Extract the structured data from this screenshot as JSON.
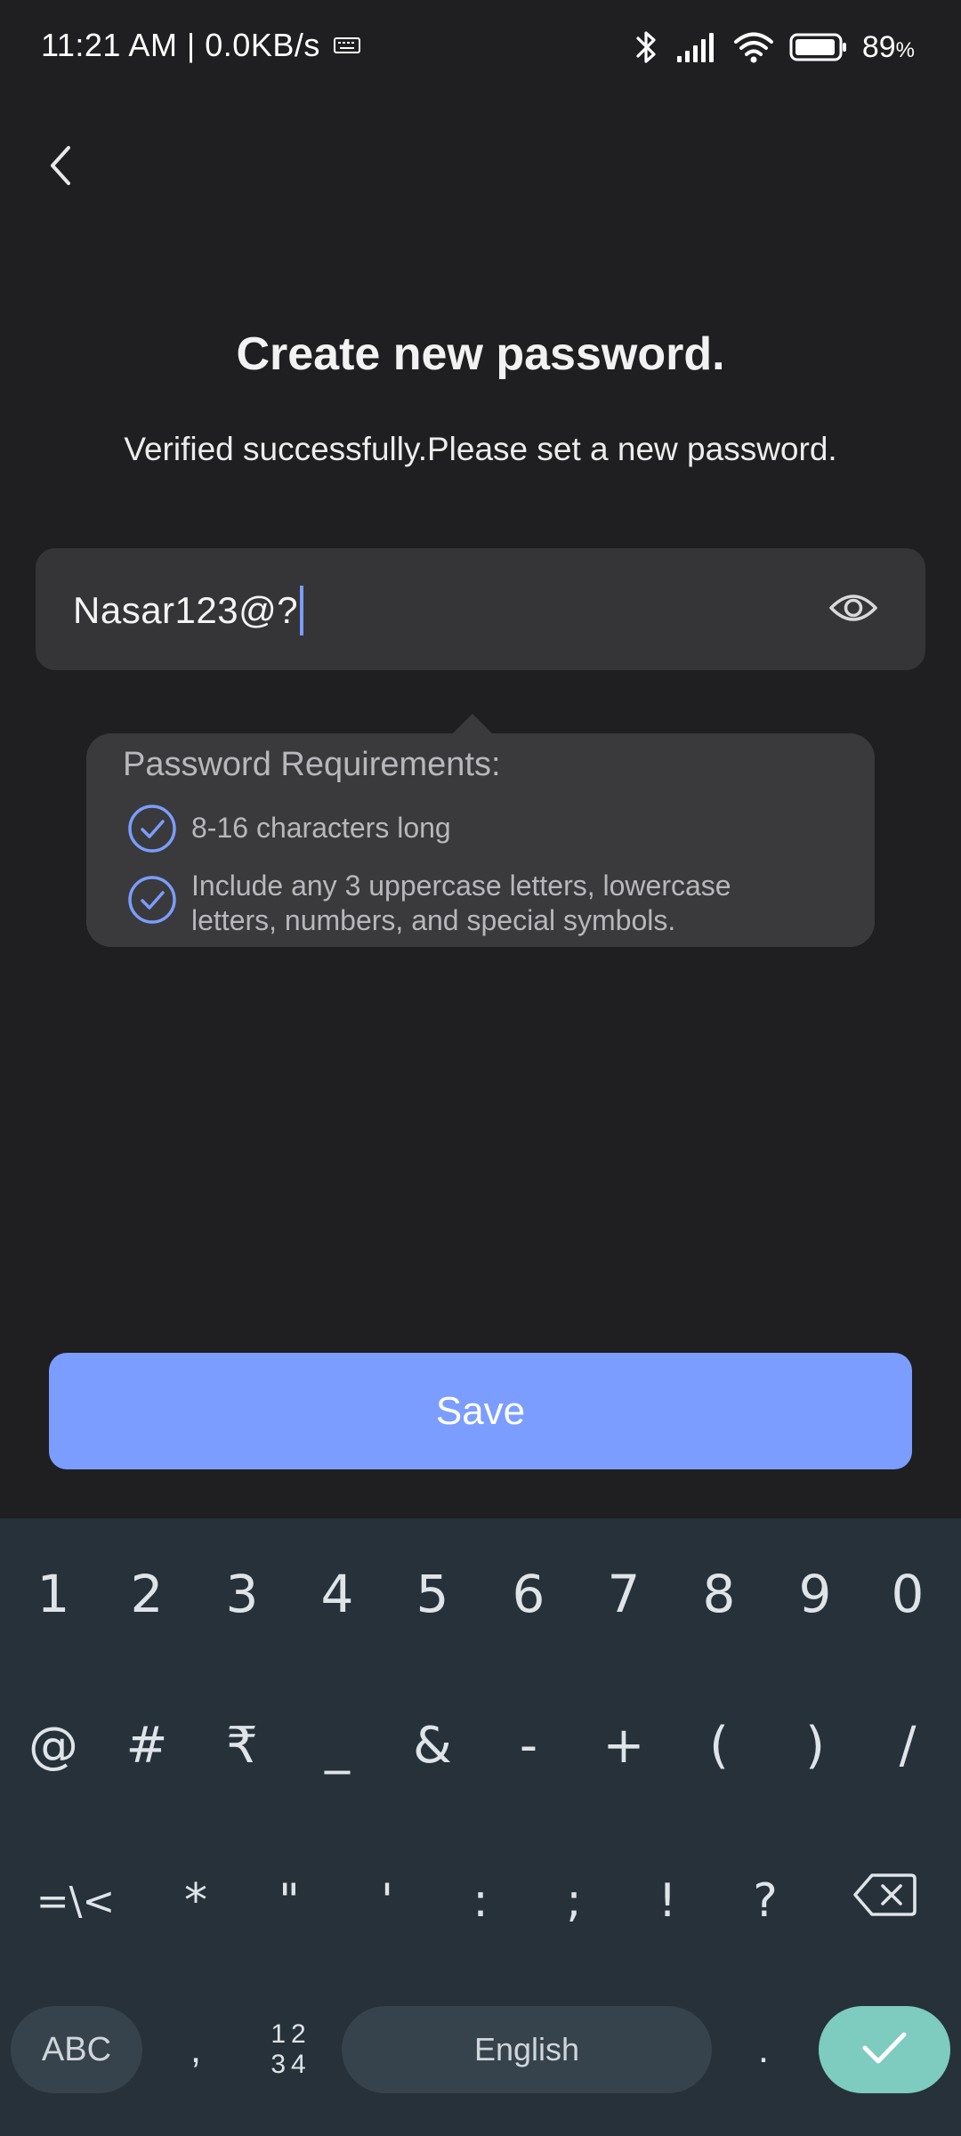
{
  "status_bar": {
    "time": "11:21 AM | 0.0KB/s",
    "battery": "89",
    "battery_unit": "%"
  },
  "header": {
    "title": "Create new password.",
    "subtitle": "Verified successfully.Please set a new password."
  },
  "password_field": {
    "value": "Nasar123@?"
  },
  "requirements": {
    "title": "Password Requirements:",
    "items": [
      {
        "text": "8-16 characters long"
      },
      {
        "text": "Include any 3 uppercase letters, lowercase letters, numbers, and special symbols."
      }
    ]
  },
  "save_label": "Save",
  "keyboard": {
    "row1": [
      "1",
      "2",
      "3",
      "4",
      "5",
      "6",
      "7",
      "8",
      "9",
      "0"
    ],
    "row2": [
      "@",
      "#",
      "₹",
      "_",
      "&",
      "-",
      "+",
      "(",
      ")",
      "/"
    ],
    "row3": [
      "=\\<",
      "*",
      "\"",
      "'",
      ":",
      ";",
      "!",
      "?"
    ],
    "abc_label": "ABC",
    "comma_label": ",",
    "num_layout_top": "12",
    "num_layout_bottom": "34",
    "space_label": "English",
    "period_label": "."
  },
  "colors": {
    "background": "#1f1f21",
    "accent": "#7b9dff",
    "keyboard_bg": "#26313a",
    "enter_key": "#7ecbc0"
  },
  "icons": [
    "back-chevron-icon",
    "eye-icon",
    "check-circle-icon",
    "backspace-icon",
    "checkmark-icon",
    "bluetooth-icon",
    "signal-icon",
    "wifi-icon",
    "battery-icon",
    "keyboard-icon"
  ]
}
